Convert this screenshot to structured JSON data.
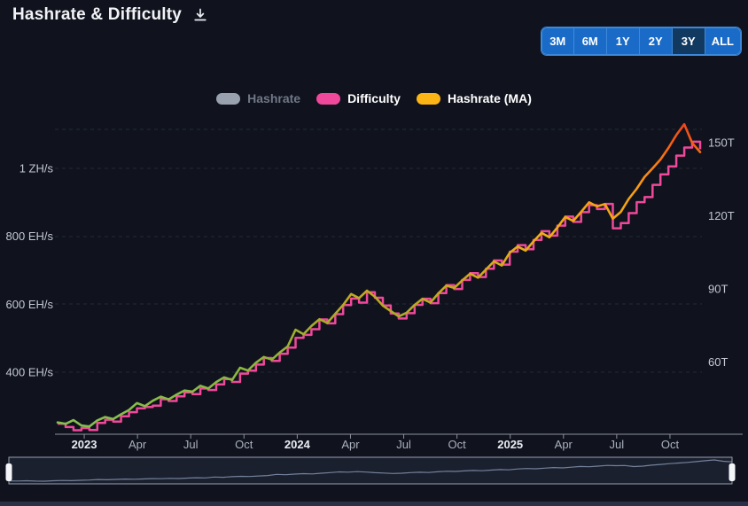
{
  "header": {
    "title": "Hashrate & Difficulty"
  },
  "range_buttons": {
    "items": [
      "3M",
      "6M",
      "1Y",
      "2Y",
      "3Y",
      "ALL"
    ],
    "active": "3Y"
  },
  "legend": {
    "items": [
      {
        "label": "Hashrate",
        "color": "#99a1af",
        "dimmed": true
      },
      {
        "label": "Difficulty",
        "color": "#f0489a",
        "dimmed": false
      },
      {
        "label": "Hashrate (MA)",
        "color": "#fdb515",
        "dimmed": false
      }
    ]
  },
  "colors": {
    "background": "#10131e",
    "difficulty": "#f0489a",
    "hashrate_ma_legend": "#fdb515",
    "button_blue": "#1a6bc7",
    "button_active": "#123a60",
    "axis_line": "#8b909a"
  },
  "chart_data": {
    "type": "line",
    "title": "Hashrate & Difficulty",
    "x_range": [
      "2022-11",
      "2025-11"
    ],
    "x_ticks": [
      {
        "label": "2023",
        "month_offset": 1.5,
        "bold": true
      },
      {
        "label": "Apr",
        "month_offset": 4.5,
        "bold": false
      },
      {
        "label": "Jul",
        "month_offset": 7.5,
        "bold": false
      },
      {
        "label": "Oct",
        "month_offset": 10.5,
        "bold": false
      },
      {
        "label": "2024",
        "month_offset": 13.5,
        "bold": true
      },
      {
        "label": "Apr",
        "month_offset": 16.5,
        "bold": false
      },
      {
        "label": "Jul",
        "month_offset": 19.5,
        "bold": false
      },
      {
        "label": "Oct",
        "month_offset": 22.5,
        "bold": false
      },
      {
        "label": "2025",
        "month_offset": 25.5,
        "bold": true
      },
      {
        "label": "Apr",
        "month_offset": 28.5,
        "bold": false
      },
      {
        "label": "Jul",
        "month_offset": 31.5,
        "bold": false
      },
      {
        "label": "Oct",
        "month_offset": 34.5,
        "bold": false
      }
    ],
    "left_axis": {
      "unit": "EH/s",
      "tick_labels": [
        "1 ZH/s",
        "800 EH/s",
        "600 EH/s",
        "400 EH/s"
      ],
      "tick_values": [
        1000,
        800,
        600,
        400
      ],
      "range": [
        240,
        1200
      ]
    },
    "right_axis": {
      "unit": "T",
      "tick_labels": [
        "150T",
        "120T",
        "90T",
        "60T"
      ],
      "tick_values": [
        150,
        120,
        90,
        60
      ],
      "range": [
        30,
        160
      ]
    },
    "series": [
      {
        "name": "Hashrate",
        "axis": "left",
        "unit": "EH/s",
        "style": "line",
        "visible": false,
        "values": []
      },
      {
        "name": "Difficulty",
        "axis": "right",
        "unit": "T",
        "style": "step",
        "visible": true,
        "color": "#f0489a",
        "values": [
          36.8,
          35.4,
          34.1,
          35.0,
          34.2,
          37.1,
          38.4,
          37.6,
          39.8,
          41.5,
          43.1,
          43.6,
          44.2,
          46.8,
          46.1,
          48.0,
          49.6,
          48.9,
          51.2,
          50.6,
          52.9,
          55.1,
          53.9,
          57.3,
          58.5,
          61.0,
          63.7,
          62.5,
          65.4,
          68.0,
          72.0,
          73.2,
          75.5,
          79.5,
          77.9,
          81.7,
          85.4,
          88.1,
          86.4,
          90.7,
          88.4,
          85.2,
          82.0,
          79.9,
          82.1,
          85.5,
          88.0,
          86.2,
          90.3,
          93.6,
          92.0,
          95.7,
          98.5,
          96.9,
          100.3,
          103.7,
          102.0,
          107.3,
          110.0,
          108.3,
          112.1,
          115.7,
          113.9,
          118.0,
          121.7,
          119.5,
          123.5,
          126.4,
          124.8,
          126.9,
          116.9,
          119.0,
          123.1,
          127.6,
          129.7,
          134.7,
          139.0,
          142.3,
          146.7,
          150.0,
          152.4,
          149.3
        ]
      },
      {
        "name": "Hashrate (MA)",
        "axis": "left",
        "unit": "EH/s",
        "style": "line",
        "visible": true,
        "color_gradient": [
          "#ee3f22",
          "#f7650f",
          "#fb9b12",
          "#edb013",
          "#cfa91a",
          "#a8ab2a",
          "#8bb63f",
          "#86c04e"
        ],
        "values": [
          252,
          248,
          259,
          243,
          240,
          258,
          268,
          262,
          276,
          289,
          309,
          300,
          316,
          328,
          320,
          334,
          346,
          343,
          360,
          352,
          371,
          385,
          377,
          413,
          405,
          428,
          445,
          437,
          458,
          476,
          525,
          512,
          536,
          556,
          545,
          572,
          598,
          630,
          618,
          640,
          622,
          596,
          580,
          564,
          575,
          598,
          616,
          605,
          632,
          655,
          648,
          670,
          690,
          678,
          702,
          726,
          714,
          752,
          770,
          758,
          785,
          810,
          797,
          826,
          857,
          845,
          872,
          900,
          888,
          895,
          852,
          872,
          910,
          940,
          975,
          1000,
          1026,
          1060,
          1098,
          1130,
          1075,
          1048
        ]
      }
    ],
    "legend_position": "top-center",
    "grid": "horizontal-dashed"
  }
}
